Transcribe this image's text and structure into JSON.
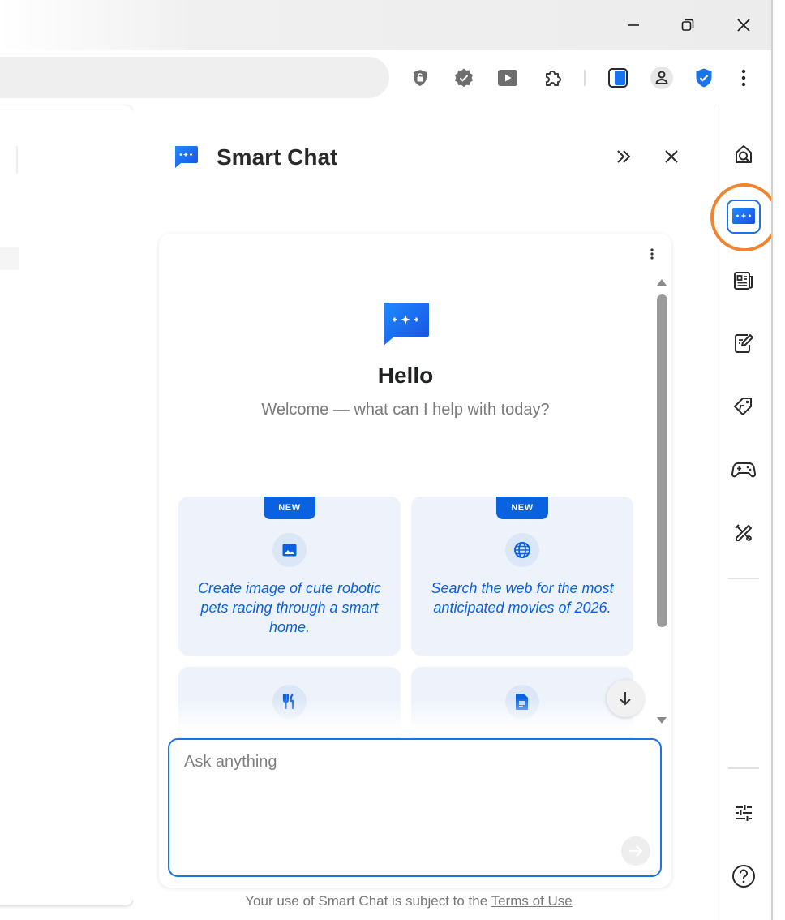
{
  "window": {
    "controls": [
      {
        "name": "minimize",
        "icon": "minimize-icon"
      },
      {
        "name": "restore",
        "icon": "restore-icon"
      },
      {
        "name": "close",
        "icon": "close-icon"
      }
    ]
  },
  "toolbar": {
    "icons": [
      "lock-shield-icon",
      "verified-badge-icon",
      "video-icon",
      "extensions-puzzle-icon",
      "sidebar-toggle-icon",
      "profile-avatar-icon",
      "security-shield-icon",
      "more-menu-icon"
    ]
  },
  "panel": {
    "title": "Smart Chat",
    "collapse_icon": "double-chevron-right-icon",
    "close_icon": "close-icon"
  },
  "chat": {
    "greeting": "Hello",
    "subtitle": "Welcome — what can I help with today?",
    "suggestions": [
      {
        "badge": "NEW",
        "icon": "image-icon",
        "text": "Create image of cute robotic pets racing through a smart home."
      },
      {
        "badge": "NEW",
        "icon": "globe-icon",
        "text": "Search the web for the most anticipated movies of 2026."
      },
      {
        "badge": "",
        "icon": "utensils-icon",
        "text": ""
      },
      {
        "badge": "",
        "icon": "document-icon",
        "text": ""
      }
    ],
    "input_placeholder": "Ask anything",
    "footer_text": "Your use of Smart Chat is subject to the ",
    "footer_link": "Terms of Use"
  },
  "rail": {
    "items": [
      "search-page-icon",
      "smart-chat-icon",
      "news-icon",
      "notes-icon",
      "deals-tag-icon",
      "games-controller-icon",
      "tools-icon",
      "customize-sliders-icon",
      "help-icon"
    ],
    "active": "smart-chat-icon",
    "highlight_color": "#f0852d"
  },
  "colors": {
    "accent": "#1a73e8",
    "badge": "#0b62e0",
    "suggestion_bg": "#edf2fb"
  }
}
